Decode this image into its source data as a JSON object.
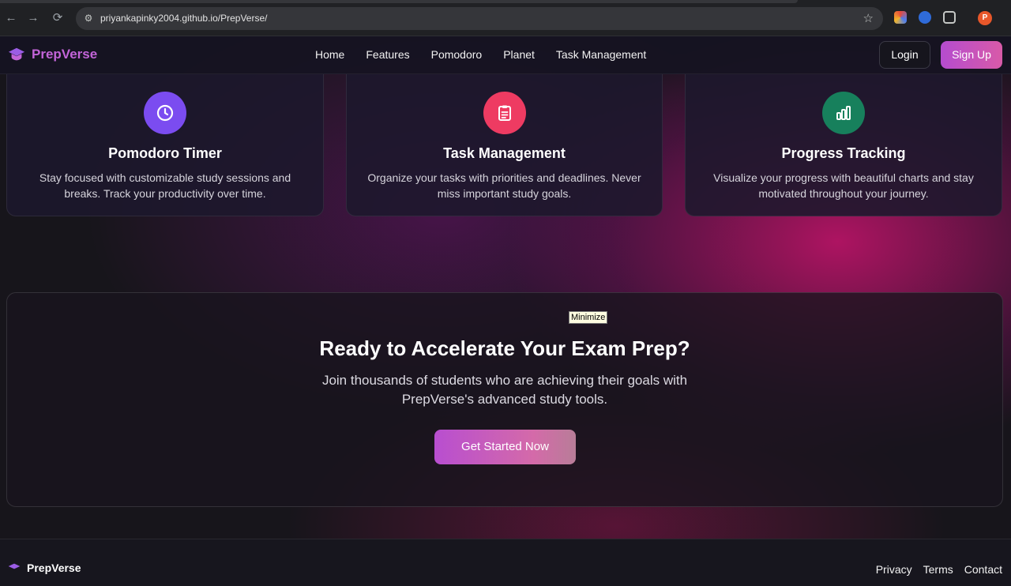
{
  "browser": {
    "url": "priyankapinky2004.github.io/PrepVerse/",
    "back_glyph": "←",
    "forward_glyph": "→",
    "reload_glyph": "⟳",
    "tune_glyph": "⚙",
    "star_glyph": "☆",
    "profile_initial": "P"
  },
  "nav": {
    "brand": "PrepVerse",
    "links": [
      "Home",
      "Features",
      "Pomodoro",
      "Planet",
      "Task Management"
    ],
    "login": "Login",
    "signup": "Sign Up"
  },
  "features": [
    {
      "title": "Pomodoro Timer",
      "text": "Stay focused with customizable study sessions and breaks. Track your productivity over time.",
      "icon": "clock-icon",
      "color": "#7b4cf0"
    },
    {
      "title": "Task Management",
      "text": "Organize your tasks with priorities and deadlines. Never miss important study goals.",
      "icon": "clipboard-icon",
      "color": "#ee3b62"
    },
    {
      "title": "Progress Tracking",
      "text": "Visualize your progress with beautiful charts and stay motivated throughout your journey.",
      "icon": "bar-chart-icon",
      "color": "#17805c"
    }
  ],
  "cta": {
    "tooltip": "Minimize",
    "heading": "Ready to Accelerate Your Exam Prep?",
    "text": "Join thousands of students who are achieving their goals with PrepVerse's advanced study tools.",
    "button": "Get Started Now"
  },
  "footer": {
    "brand": "PrepVerse",
    "links": [
      "Privacy",
      "Terms",
      "Contact"
    ]
  }
}
